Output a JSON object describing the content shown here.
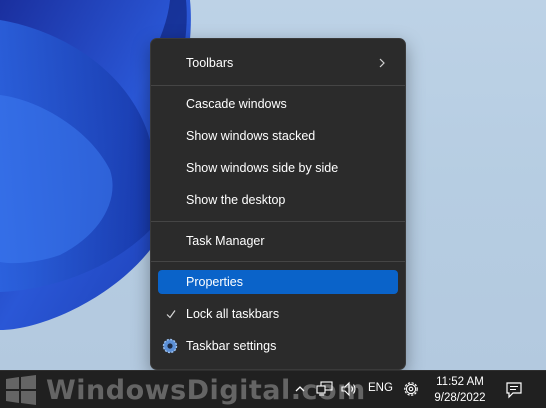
{
  "menu": {
    "items": [
      {
        "label": "Toolbars",
        "has_submenu": true
      },
      {
        "label": "Cascade windows"
      },
      {
        "label": "Show windows stacked"
      },
      {
        "label": "Show windows side by side"
      },
      {
        "label": "Show the desktop"
      },
      {
        "label": "Task Manager"
      },
      {
        "label": "Properties",
        "selected": true
      },
      {
        "label": "Lock all taskbars",
        "checked": true
      },
      {
        "label": "Taskbar settings",
        "icon": "gear-icon"
      }
    ]
  },
  "taskbar": {
    "watermark": "WindowsDigital.com",
    "language": "ENG",
    "time": "11:52 AM",
    "date": "9/28/2022"
  },
  "colors": {
    "menu_bg": "#2b2b2b",
    "selected": "#0a63c9",
    "taskbar_bg": "#202020",
    "desktop": "#b9cfe2",
    "bloom": "#1e3fb8"
  }
}
